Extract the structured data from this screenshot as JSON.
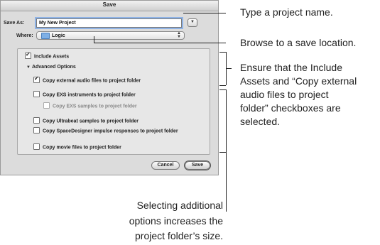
{
  "dialog": {
    "title": "Save",
    "save_as_label": "Save As:",
    "save_as_value": "My New Project",
    "where_label": "Where:",
    "where_value": "Logic",
    "expand_icon": "chevron-down-icon",
    "folder_icon": "folder-icon"
  },
  "options": {
    "include_assets": {
      "label": "Include Assets",
      "checked": true
    },
    "advanced_label": "Advanced Options",
    "items": [
      {
        "label": "Copy external audio files to project folder",
        "checked": true
      },
      {
        "label": "Copy EXS instruments to project folder",
        "checked": false
      },
      {
        "label": "Copy EXS samples to project folder",
        "checked": false
      },
      {
        "label": "Copy Ultrabeat samples to project folder",
        "checked": false
      },
      {
        "label": "Copy SpaceDesigner impulse responses to project folder",
        "checked": false
      },
      {
        "label": "Copy movie files to project folder",
        "checked": false
      }
    ]
  },
  "buttons": {
    "cancel": "Cancel",
    "save": "Save"
  },
  "callouts": {
    "name": "Type a project name.",
    "location": "Browse to a save location.",
    "assets_1": "Ensure that the Include",
    "assets_2": "Assets and “Copy external",
    "assets_3": "audio files to project",
    "assets_4": "folder” checkboxes are",
    "assets_5": "selected.",
    "size_1": "Selecting additional",
    "size_2": "options increases the",
    "size_3": "project folder’s size."
  }
}
